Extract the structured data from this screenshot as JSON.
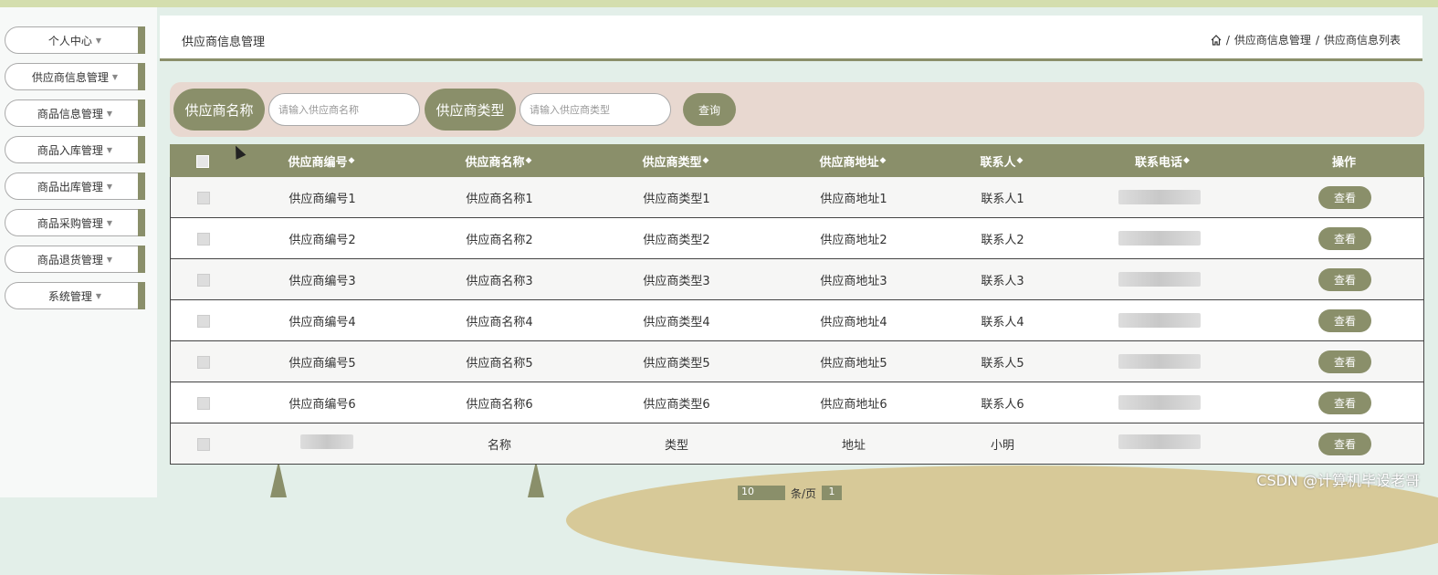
{
  "sidebar": {
    "items": [
      {
        "label": "个人中心"
      },
      {
        "label": "供应商信息管理"
      },
      {
        "label": "商品信息管理"
      },
      {
        "label": "商品入库管理"
      },
      {
        "label": "商品出库管理"
      },
      {
        "label": "商品采购管理"
      },
      {
        "label": "商品退货管理"
      },
      {
        "label": "系统管理"
      }
    ]
  },
  "header": {
    "title": "供应商信息管理",
    "breadcrumb": [
      "供应商信息管理",
      "供应商信息列表"
    ],
    "separator": "/"
  },
  "search": {
    "name_label": "供应商名称",
    "name_placeholder": "请输入供应商名称",
    "type_label": "供应商类型",
    "type_placeholder": "请输入供应商类型",
    "query_button": "查询"
  },
  "table": {
    "columns": [
      "供应商编号",
      "供应商名称",
      "供应商类型",
      "供应商地址",
      "联系人",
      "联系电话",
      "操作"
    ],
    "sort_glyph": "◆",
    "rows": [
      {
        "code": "供应商编号1",
        "name": "供应商名称1",
        "type": "供应商类型1",
        "address": "供应商地址1",
        "contact": "联系人1",
        "action": "查看"
      },
      {
        "code": "供应商编号2",
        "name": "供应商名称2",
        "type": "供应商类型2",
        "address": "供应商地址2",
        "contact": "联系人2",
        "action": "查看"
      },
      {
        "code": "供应商编号3",
        "name": "供应商名称3",
        "type": "供应商类型3",
        "address": "供应商地址3",
        "contact": "联系人3",
        "action": "查看"
      },
      {
        "code": "供应商编号4",
        "name": "供应商名称4",
        "type": "供应商类型4",
        "address": "供应商地址4",
        "contact": "联系人4",
        "action": "查看"
      },
      {
        "code": "供应商编号5",
        "name": "供应商名称5",
        "type": "供应商类型5",
        "address": "供应商地址5",
        "contact": "联系人5",
        "action": "查看"
      },
      {
        "code": "供应商编号6",
        "name": "供应商名称6",
        "type": "供应商类型6",
        "address": "供应商地址6",
        "contact": "联系人6",
        "action": "查看"
      },
      {
        "code": "",
        "name": "名称",
        "type": "类型",
        "address": "地址",
        "contact": "小明",
        "action": "查看"
      }
    ]
  },
  "pagination": {
    "page_size": "10",
    "label": "条/页",
    "current": "1"
  },
  "watermark": "CSDN @计算机毕设老哥",
  "colors": {
    "accent": "#8a8f6a",
    "search_bg": "#e8d8d0",
    "top_strip": "#d4deae"
  }
}
